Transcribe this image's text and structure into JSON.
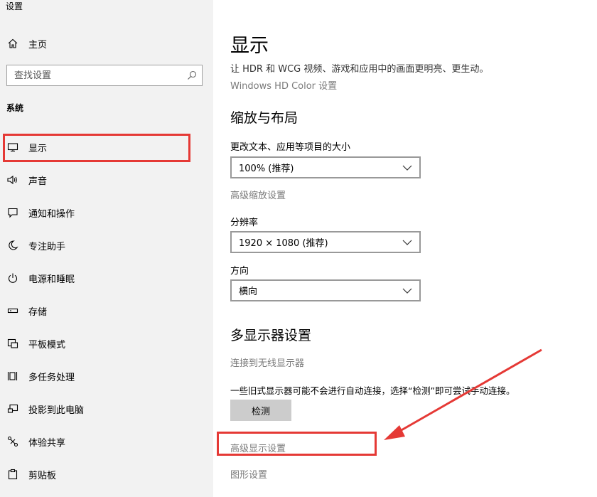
{
  "window": {
    "title": "设置"
  },
  "sidebar": {
    "home_label": "主页",
    "search_placeholder": "查找设置",
    "section_label": "系统",
    "items": [
      {
        "label": "显示",
        "icon": "monitor-icon"
      },
      {
        "label": "声音",
        "icon": "speaker-icon"
      },
      {
        "label": "通知和操作",
        "icon": "notification-icon"
      },
      {
        "label": "专注助手",
        "icon": "moon-icon"
      },
      {
        "label": "电源和睡眠",
        "icon": "power-icon"
      },
      {
        "label": "存储",
        "icon": "storage-icon"
      },
      {
        "label": "平板模式",
        "icon": "tablet-mode-icon"
      },
      {
        "label": "多任务处理",
        "icon": "multitask-icon"
      },
      {
        "label": "投影到此电脑",
        "icon": "project-icon"
      },
      {
        "label": "体验共享",
        "icon": "shared-experience-icon"
      },
      {
        "label": "剪贴板",
        "icon": "clipboard-icon"
      }
    ]
  },
  "main": {
    "title": "显示",
    "hdr_desc": "让 HDR 和 WCG 视频、游戏和应用中的画面更明亮、更生动。",
    "hdr_link": "Windows HD Color 设置",
    "scale_heading": "缩放与布局",
    "scale_label": "更改文本、应用等项目的大小",
    "scale_value": "100% (推荐)",
    "advanced_scale_link": "高级缩放设置",
    "resolution_label": "分辨率",
    "resolution_value": "1920 × 1080 (推荐)",
    "orientation_label": "方向",
    "orientation_value": "横向",
    "multi_heading": "多显示器设置",
    "wireless_link": "连接到无线显示器",
    "detect_desc": "一些旧式显示器可能不会进行自动连接，选择“检测”即可尝试手动连接。",
    "detect_button": "检测",
    "advanced_display_link": "高级显示设置",
    "graphics_link": "图形设置"
  },
  "colors": {
    "highlight": "#e53935",
    "sidebar_bg": "#f2f2f2",
    "link_gray": "#7a7a7a"
  }
}
